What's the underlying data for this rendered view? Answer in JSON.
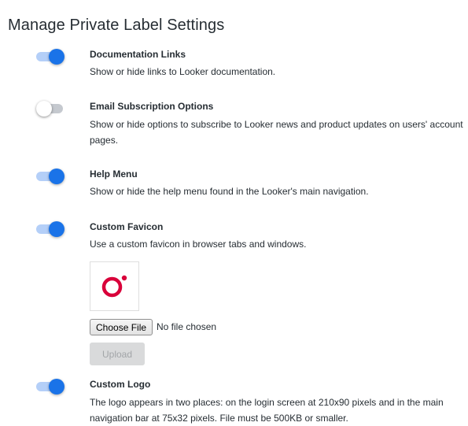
{
  "page": {
    "title": "Manage Private Label Settings"
  },
  "settings": [
    {
      "title": "Documentation Links",
      "description": "Show or hide links to Looker documentation.",
      "enabled": true
    },
    {
      "title": "Email Subscription Options",
      "description": "Show or hide options to subscribe to Looker news and product updates on users' account pages.",
      "enabled": false
    },
    {
      "title": "Help Menu",
      "description": "Show or hide the help menu found in the Looker's main navigation.",
      "enabled": true
    },
    {
      "title": "Custom Favicon",
      "description": "Use a custom favicon in browser tabs and windows.",
      "enabled": true
    },
    {
      "title": "Custom Logo",
      "description": "The logo appears in two places: on the login screen at 210x90 pixels and in the main navigation bar at 75x32 pixels. File must be 500KB or smaller.",
      "enabled": true
    }
  ],
  "favicon_upload": {
    "choose_file_label": "Choose File",
    "no_file_text": "No file chosen",
    "upload_label": "Upload",
    "upload_disabled": true,
    "preview_icon": "looker-o-logo",
    "logo_color": "#d9003a"
  },
  "colors": {
    "accent": "#1a73e8",
    "track_on": "#b4cff8",
    "track_off": "#c5c9cf"
  }
}
